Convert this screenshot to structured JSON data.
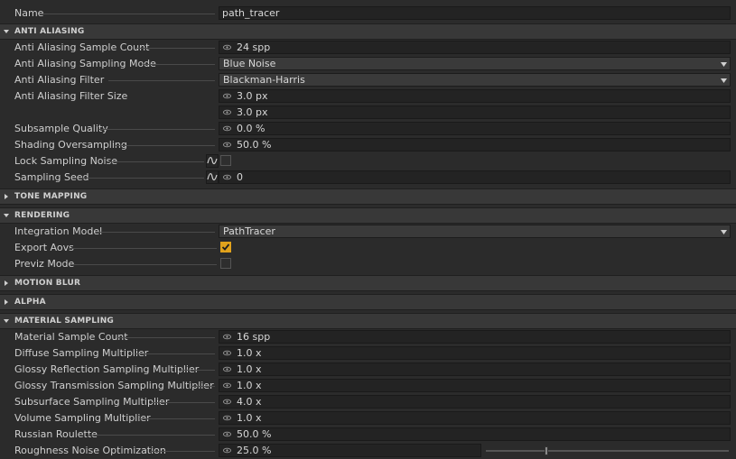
{
  "name_row": {
    "label": "Name",
    "value": "path_tracer"
  },
  "anti_aliasing": {
    "title": "ANTI ALIASING",
    "sample_count": {
      "label": "Anti Aliasing Sample Count",
      "value": "24 spp"
    },
    "sampling_mode": {
      "label": "Anti Aliasing Sampling Mode",
      "value": "Blue Noise"
    },
    "filter": {
      "label": "Anti Aliasing Filter",
      "value": "Blackman-Harris"
    },
    "filter_size": {
      "label": "Anti Aliasing Filter Size",
      "value_x": "3.0 px",
      "value_y": "3.0 px"
    },
    "subsample_quality": {
      "label": "Subsample Quality",
      "value": "0.0 %"
    },
    "shading_oversampling": {
      "label": "Shading Oversampling",
      "value": "50.0 %"
    },
    "lock_sampling_noise": {
      "label": "Lock Sampling Noise",
      "checked": false
    },
    "sampling_seed": {
      "label": "Sampling Seed",
      "value": "0"
    }
  },
  "tone_mapping": {
    "title": "TONE MAPPING"
  },
  "rendering": {
    "title": "RENDERING",
    "integration_model": {
      "label": "Integration Model",
      "value": "PathTracer"
    },
    "export_aovs": {
      "label": "Export Aovs",
      "checked": true
    },
    "previz_mode": {
      "label": "Previz Mode",
      "checked": false
    }
  },
  "motion_blur": {
    "title": "MOTION BLUR"
  },
  "alpha": {
    "title": "ALPHA"
  },
  "material_sampling": {
    "title": "MATERIAL SAMPLING",
    "material_sample_count": {
      "label": "Material Sample Count",
      "value": "16 spp"
    },
    "diffuse": {
      "label": "Diffuse Sampling Multiplier",
      "value": "1.0 x"
    },
    "glossy_reflection": {
      "label": "Glossy Reflection Sampling Multiplier",
      "value": "1.0 x"
    },
    "glossy_transmission": {
      "label": "Glossy Transmission Sampling Multiplier",
      "value": "1.0 x"
    },
    "subsurface": {
      "label": "Subsurface Sampling Multiplier",
      "value": "4.0 x"
    },
    "volume": {
      "label": "Volume Sampling Multiplier",
      "value": "1.0 x"
    },
    "russian_roulette": {
      "label": "Russian Roulette",
      "value": "50.0 %"
    },
    "roughness_noise": {
      "label": "Roughness Noise Optimization",
      "value": "25.0 %",
      "slider_level": 0.25
    }
  },
  "colors": {
    "accent": "#e1a21c",
    "background": "#2b2b2b",
    "section": "#383838"
  },
  "icons": {
    "eye": "eye-icon",
    "curve": "curve-icon",
    "collapse": "triangle-icon",
    "dropdown": "chevron-down-icon"
  }
}
